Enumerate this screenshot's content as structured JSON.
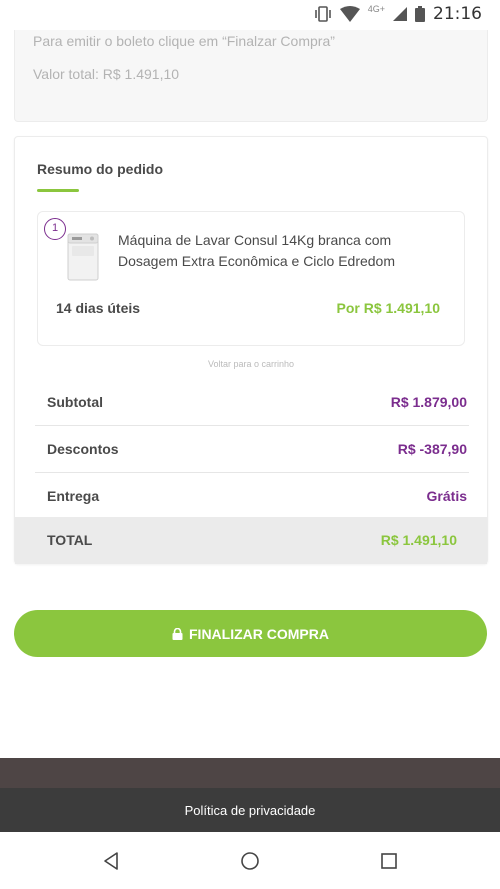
{
  "status_bar": {
    "network_label": "4G+",
    "time": "21:16"
  },
  "payment_info": {
    "instruction": "Para emitir o boleto clique em “Finalzar Compra”",
    "total_label": "Valor total: R$ 1.491,10"
  },
  "summary": {
    "title": "Resumo do pedido",
    "item": {
      "quantity": "1",
      "name": "Máquina de Lavar Consul 14Kg branca com Dosagem Extra Econômica e Ciclo Edredom",
      "delivery": "14 dias úteis",
      "price": "Por R$ 1.491,10"
    },
    "back_link": "Voltar para o carrinho",
    "rows": {
      "subtotal_label": "Subtotal",
      "subtotal_value": "R$ 1.879,00",
      "discount_label": "Descontos",
      "discount_value": "R$ -387,90",
      "shipping_label": "Entrega",
      "shipping_value": "Grátis",
      "total_label": "TOTAL",
      "total_value": "R$ 1.491,10"
    }
  },
  "cta": {
    "label": "FINALIZAR COMPRA",
    "icon": "lock-icon"
  },
  "footer": {
    "privacy_link": "Política de privacidade"
  },
  "colors": {
    "brand_green": "#8bc63e",
    "brand_purple": "#7b2d8e",
    "footer_dark": "#3c3c3c"
  }
}
